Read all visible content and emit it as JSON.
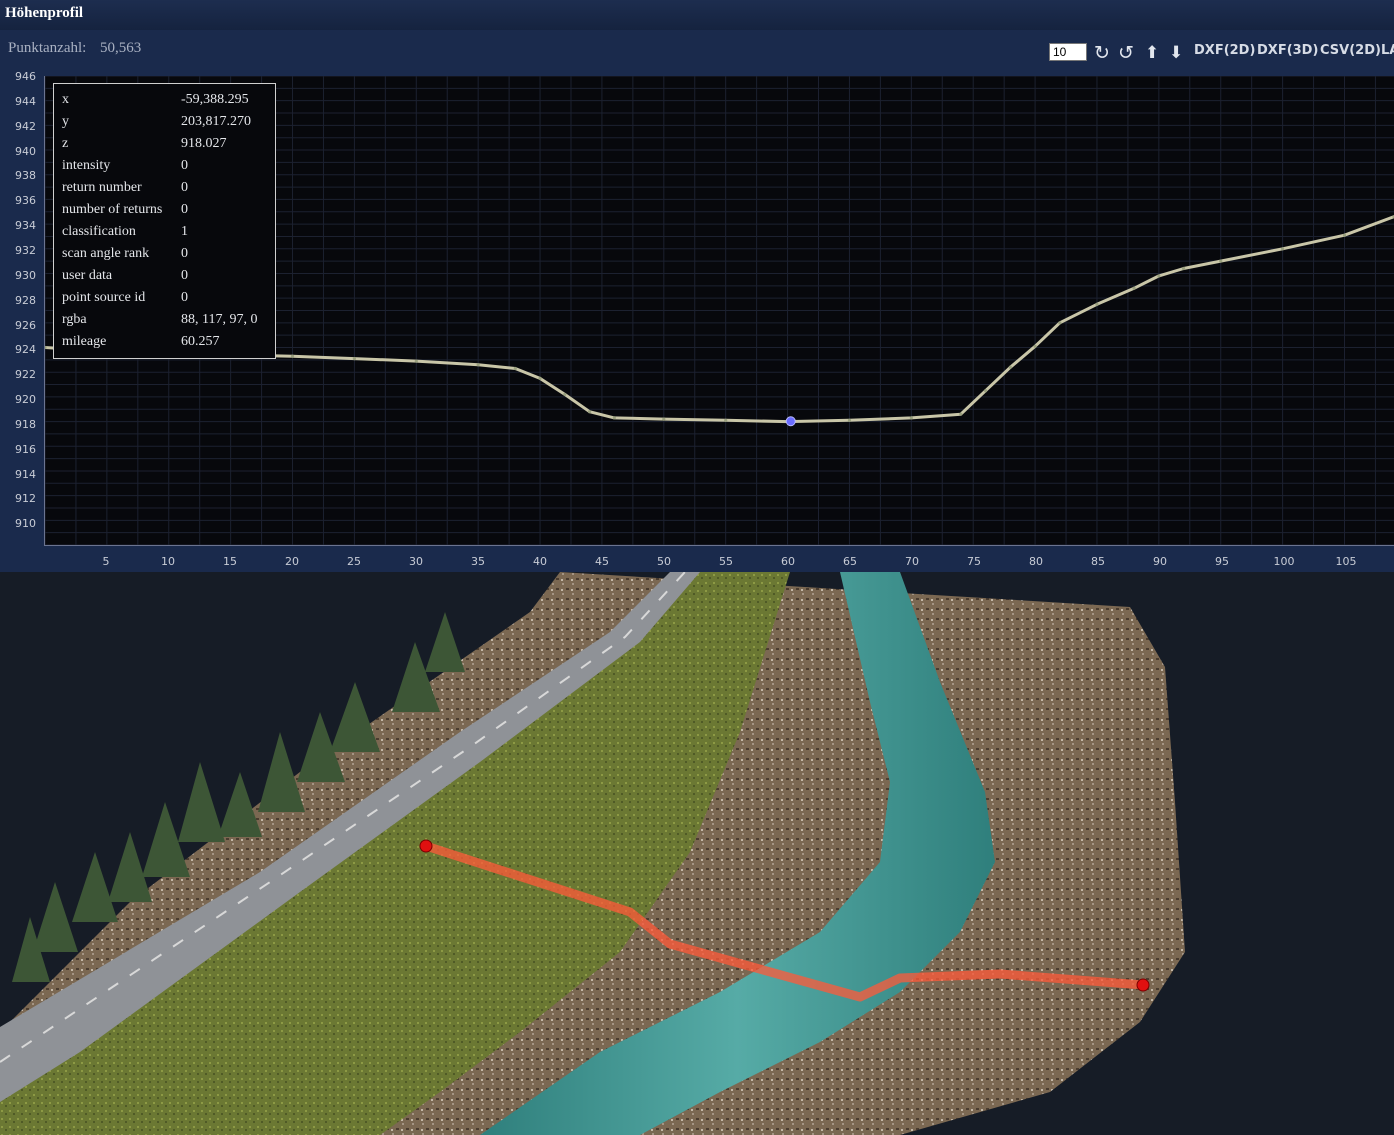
{
  "window": {
    "title": "Höhenprofil"
  },
  "toolbar": {
    "point_count_label": "Punktanzahl:",
    "point_count_value": "50,563",
    "width_value": "10",
    "rotate_cw_icon": "rotate-cw-icon",
    "rotate_ccw_icon": "rotate-ccw-icon",
    "move_up_icon": "arrow-up-icon",
    "move_down_icon": "arrow-down-icon",
    "dxf2d_label": "DXF(2D)",
    "dxf3d_label": "DXF(3D)",
    "csv2d_label": "CSV(2D)",
    "las_label": "LA"
  },
  "profile": {
    "y_ticks": [
      "946",
      "944",
      "942",
      "940",
      "938",
      "936",
      "934",
      "932",
      "930",
      "928",
      "926",
      "924",
      "922",
      "920",
      "918",
      "916",
      "914",
      "912",
      "910"
    ],
    "x_ticks": [
      "5",
      "10",
      "15",
      "20",
      "25",
      "30",
      "35",
      "40",
      "45",
      "50",
      "55",
      "60",
      "65",
      "70",
      "75",
      "80",
      "85",
      "90",
      "95",
      "100",
      "105"
    ],
    "colors": {
      "background": "#07080c",
      "grid": "#1c2130",
      "selected_point": "#6a6cff"
    }
  },
  "chart_data": {
    "type": "scatter",
    "xlabel": "",
    "ylabel": "",
    "xlim": [
      0,
      109
    ],
    "ylim": [
      908,
      946
    ],
    "grid": true,
    "series": [
      {
        "x": [
          0,
          5,
          10,
          15,
          20,
          25,
          30,
          35,
          38,
          40,
          42,
          44,
          46,
          50,
          55,
          60,
          65,
          70,
          74,
          76,
          78,
          80,
          82,
          85,
          88,
          90,
          92,
          95,
          100,
          105,
          109
        ],
        "y": [
          924,
          923.7,
          923.5,
          923.4,
          923.3,
          923.1,
          922.9,
          922.6,
          922.3,
          921.5,
          920.2,
          918.8,
          918.3,
          918.2,
          918.1,
          918.0,
          918.1,
          918.3,
          918.6,
          920.5,
          922.4,
          924.1,
          926.0,
          927.5,
          928.8,
          929.8,
          930.4,
          931.0,
          932.0,
          933.1,
          934.6
        ]
      }
    ],
    "highlight": {
      "x": 60.257,
      "y": 918.027
    }
  },
  "point_info": [
    {
      "key": "x",
      "value": "-59,388.295"
    },
    {
      "key": "y",
      "value": "203,817.270"
    },
    {
      "key": "z",
      "value": "918.027"
    },
    {
      "key": "intensity",
      "value": "0"
    },
    {
      "key": "return number",
      "value": "0"
    },
    {
      "key": "number of returns",
      "value": "0"
    },
    {
      "key": "classification",
      "value": "1"
    },
    {
      "key": "scan angle rank",
      "value": "0"
    },
    {
      "key": "user data",
      "value": "0"
    },
    {
      "key": "point source id",
      "value": "0"
    },
    {
      "key": "rgba",
      "value": "88, 117, 97, 0"
    },
    {
      "key": "mileage",
      "value": "60.257"
    }
  ],
  "viewer": {
    "colors": {
      "background": "#161c26",
      "meadow": "#6f7a35",
      "road": "#8e9196",
      "river": "#3f9a95",
      "rock": "#7d6a55",
      "trees": "#3f5a35",
      "profile_line": "#ff5a3a",
      "endpoint": "#e01010"
    }
  }
}
